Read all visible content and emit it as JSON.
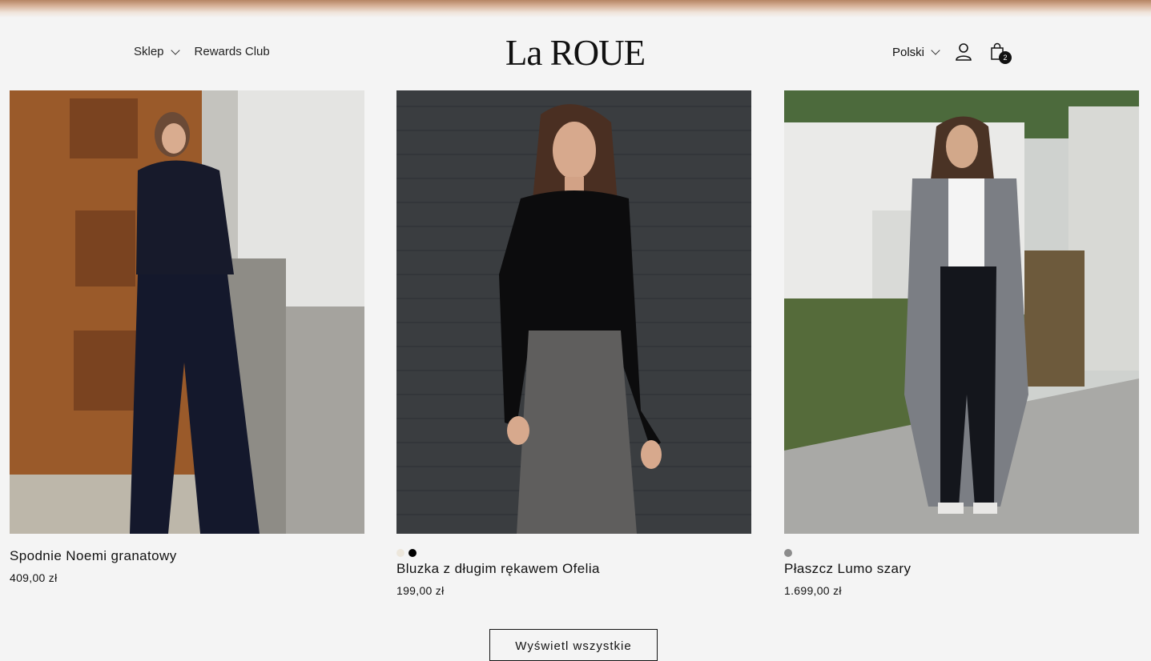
{
  "header": {
    "nav": [
      {
        "label": "Sklep",
        "has_dropdown": true
      },
      {
        "label": "Rewards Club",
        "has_dropdown": false
      }
    ],
    "logo": "La ROUE",
    "language": "Polski",
    "cart_count": "2",
    "icons": [
      "chevron-down-icon",
      "user-icon",
      "shopping-bag-icon"
    ]
  },
  "products": [
    {
      "title": "Spodnie Noemi granatowy",
      "price": "409,00 zł",
      "swatches": []
    },
    {
      "title": "Bluzka z długim rękawem Ofelia",
      "price": "199,00 zł",
      "swatches": [
        "#ede7dc",
        "#000000"
      ]
    },
    {
      "title": "Płaszcz Lumo szary",
      "price": "1.699,00 zł",
      "swatches": [
        "#8c8c8c"
      ]
    }
  ],
  "view_all_label": "Wyświetl wszystkie"
}
